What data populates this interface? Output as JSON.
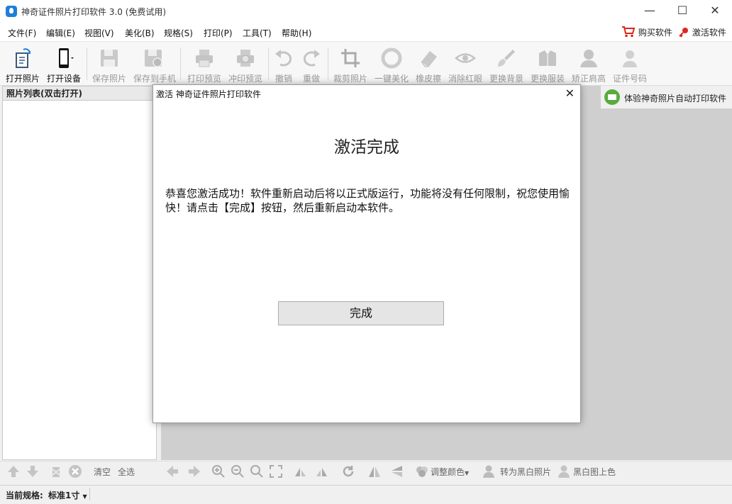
{
  "window": {
    "title": "神奇证件照片打印软件 3.0 (免费试用)",
    "minimize": "—",
    "maximize": "☐",
    "close": "✕"
  },
  "menu": {
    "items": [
      "文件(F)",
      "编辑(E)",
      "视图(V)",
      "美化(B)",
      "规格(S)",
      "打印(P)",
      "工具(T)",
      "帮助(H)"
    ],
    "buy_label": "购买软件",
    "activate_label": "激活软件"
  },
  "toolbar": {
    "buttons": [
      {
        "label": "打开照片",
        "icon": "open-photo-icon",
        "enabled": true
      },
      {
        "label": "打开设备",
        "icon": "phone-icon",
        "enabled": true
      },
      {
        "label": "保存照片",
        "icon": "save-icon",
        "enabled": false
      },
      {
        "label": "保存到手机",
        "icon": "save-to-phone-icon",
        "enabled": false
      },
      {
        "label": "打印预览",
        "icon": "printer-icon",
        "enabled": false
      },
      {
        "label": "冲印预览",
        "icon": "photo-print-icon",
        "enabled": false
      },
      {
        "label": "撤销",
        "icon": "undo-icon",
        "enabled": false
      },
      {
        "label": "重做",
        "icon": "redo-icon",
        "enabled": false
      },
      {
        "label": "裁剪照片",
        "icon": "crop-icon",
        "enabled": false
      },
      {
        "label": "一键美化",
        "icon": "beautify-icon",
        "enabled": false
      },
      {
        "label": "橡皮擦",
        "icon": "eraser-icon",
        "enabled": false
      },
      {
        "label": "消除红眼",
        "icon": "eye-icon",
        "enabled": false
      },
      {
        "label": "更换背景",
        "icon": "brush-icon",
        "enabled": false
      },
      {
        "label": "更换服装",
        "icon": "suit-icon",
        "enabled": false
      },
      {
        "label": "矫正肩高",
        "icon": "shoulder-icon",
        "enabled": false
      },
      {
        "label": "证件号码",
        "icon": "id-person-icon",
        "enabled": false
      }
    ]
  },
  "left_panel": {
    "header": "照片列表(双击打开)",
    "clear_label": "清空",
    "select_all_label": "全选"
  },
  "workarea": {
    "auto_print_link": "体验神奇照片自动打印软件"
  },
  "bottom_toolbar": {
    "adjust_color": "调整颜色",
    "to_bw": "转为黑白照片",
    "bw_colorize": "黑白图上色"
  },
  "status": {
    "label": "当前规格:",
    "value": "标准1寸"
  },
  "dialog": {
    "title": "激活 神奇证件照片打印软件",
    "heading": "激活完成",
    "message": "恭喜您激活成功！软件重新启动后将以正式版运行，功能将没有任何限制，祝您使用愉快！请点击【完成】按钮，然后重新启动本软件。",
    "done_button": "完成"
  },
  "colors": {
    "accent": "#1e7fd8",
    "cart": "#d9281e",
    "key": "#d9281e",
    "green": "#5aab3c"
  }
}
